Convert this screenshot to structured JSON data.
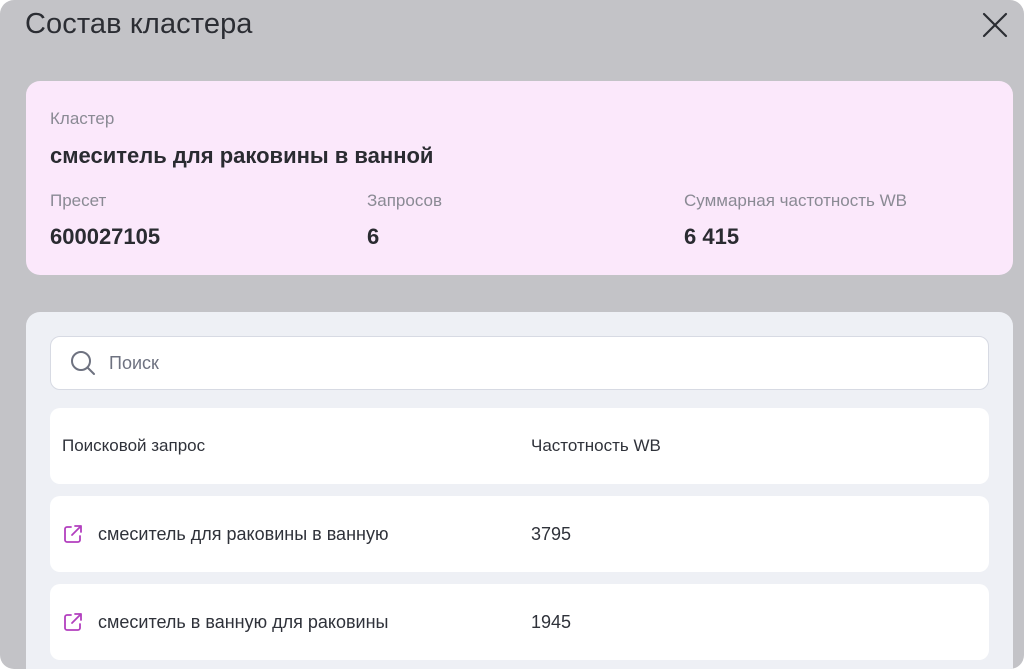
{
  "modal": {
    "title": "Состав кластера"
  },
  "info": {
    "cluster_label": "Кластер",
    "cluster_name": "смеситель для раковины в ванной",
    "preset_label": "Пресет",
    "preset_value": "600027105",
    "queries_label": "Запросов",
    "queries_value": "6",
    "total_freq_label": "Суммарная частотность WB",
    "total_freq_value": "6 415"
  },
  "search": {
    "placeholder": "Поиск"
  },
  "table": {
    "headers": {
      "query": "Поисковой запрос",
      "frequency": "Частотность WB"
    },
    "rows": [
      {
        "query": "смеситель для раковины в ванную",
        "frequency": "3795"
      },
      {
        "query": "смеситель в ванную для раковины",
        "frequency": "1945"
      }
    ]
  },
  "colors": {
    "overlay": "#c3c3c7",
    "info_card": "#fbe8fb",
    "accent_icon": "#b23fbf"
  }
}
